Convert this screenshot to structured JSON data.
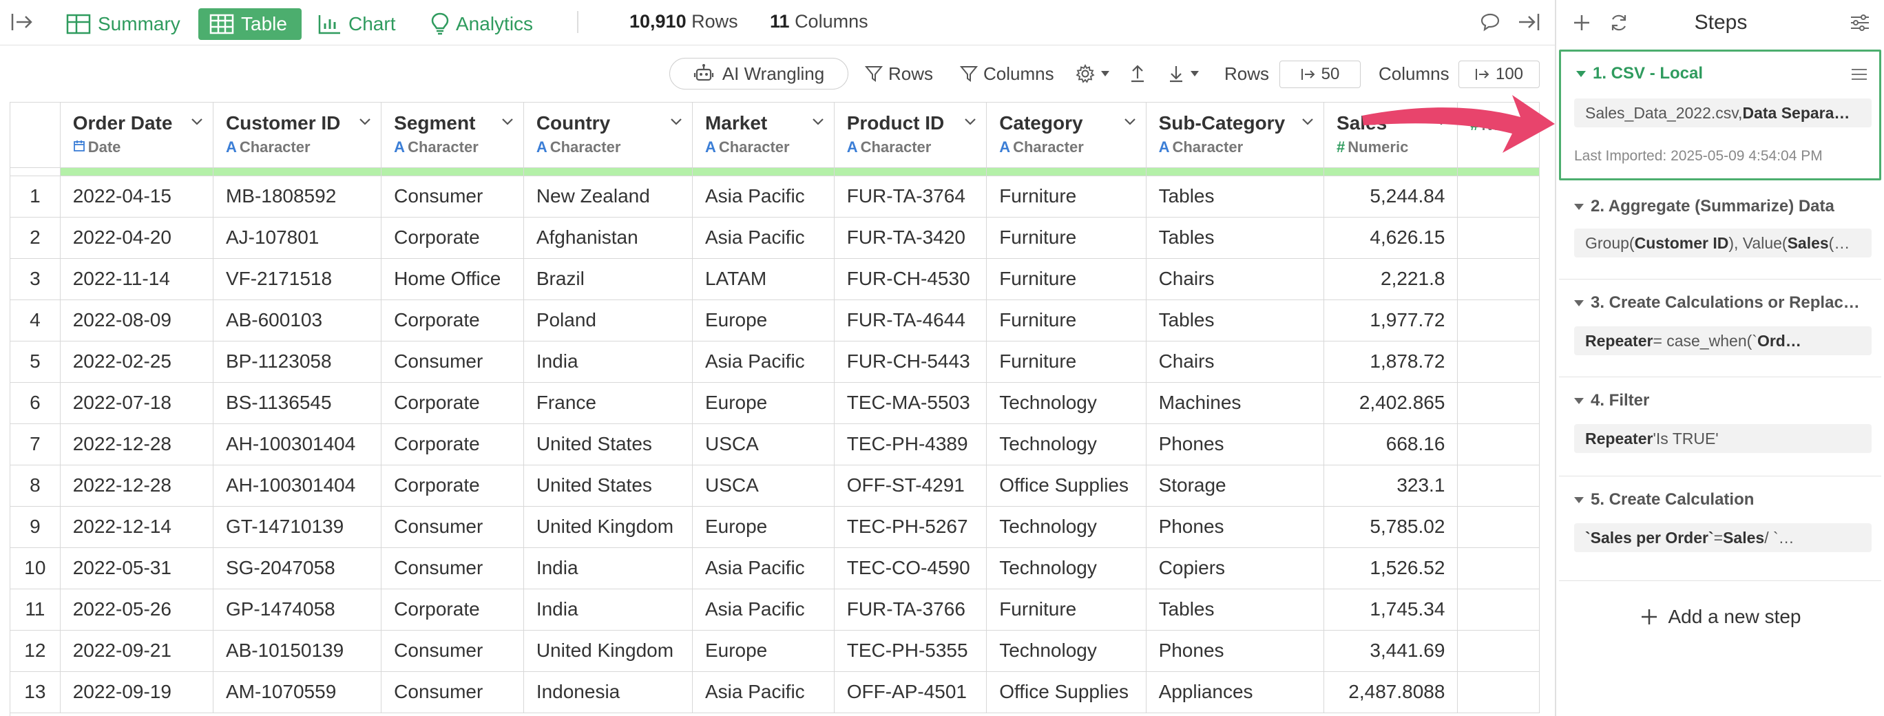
{
  "topbar": {
    "tabs": [
      {
        "label": "Summary",
        "icon": "summary-icon",
        "active": false
      },
      {
        "label": "Table",
        "icon": "table-icon",
        "active": true
      },
      {
        "label": "Chart",
        "icon": "chart-icon",
        "active": false
      },
      {
        "label": "Analytics",
        "icon": "lightbulb-icon",
        "active": false
      }
    ],
    "rows_count": "10,910",
    "rows_label": "Rows",
    "columns_count": "11",
    "columns_label": "Columns"
  },
  "toolbar": {
    "ai_wrangling": "AI Wrangling",
    "rows_filter": "Rows",
    "columns_filter": "Columns",
    "rows_label": "Rows",
    "rows_value": "50",
    "columns_label": "Columns",
    "columns_value": "100"
  },
  "table": {
    "columns": [
      {
        "name": "Order Date",
        "type": "Date"
      },
      {
        "name": "Customer ID",
        "type": "Character"
      },
      {
        "name": "Segment",
        "type": "Character"
      },
      {
        "name": "Country",
        "type": "Character"
      },
      {
        "name": "Market",
        "type": "Character"
      },
      {
        "name": "Product ID",
        "type": "Character"
      },
      {
        "name": "Category",
        "type": "Character"
      },
      {
        "name": "Sub-Category",
        "type": "Character"
      },
      {
        "name": "Sales",
        "type": "Numeric"
      },
      {
        "name": "",
        "type": "Num"
      }
    ],
    "rows": [
      [
        "1",
        "2022-04-15",
        "MB-1808592",
        "Consumer",
        "New Zealand",
        "Asia Pacific",
        "FUR-TA-3764",
        "Furniture",
        "Tables",
        "5,244.84"
      ],
      [
        "2",
        "2022-04-20",
        "AJ-107801",
        "Corporate",
        "Afghanistan",
        "Asia Pacific",
        "FUR-TA-3420",
        "Furniture",
        "Tables",
        "4,626.15"
      ],
      [
        "3",
        "2022-11-14",
        "VF-2171518",
        "Home Office",
        "Brazil",
        "LATAM",
        "FUR-CH-4530",
        "Furniture",
        "Chairs",
        "2,221.8"
      ],
      [
        "4",
        "2022-08-09",
        "AB-600103",
        "Corporate",
        "Poland",
        "Europe",
        "FUR-TA-4644",
        "Furniture",
        "Tables",
        "1,977.72"
      ],
      [
        "5",
        "2022-02-25",
        "BP-1123058",
        "Consumer",
        "India",
        "Asia Pacific",
        "FUR-CH-5443",
        "Furniture",
        "Chairs",
        "1,878.72"
      ],
      [
        "6",
        "2022-07-18",
        "BS-1136545",
        "Corporate",
        "France",
        "Europe",
        "TEC-MA-5503",
        "Technology",
        "Machines",
        "2,402.865"
      ],
      [
        "7",
        "2022-12-28",
        "AH-100301404",
        "Corporate",
        "United States",
        "USCA",
        "TEC-PH-4389",
        "Technology",
        "Phones",
        "668.16"
      ],
      [
        "8",
        "2022-12-28",
        "AH-100301404",
        "Corporate",
        "United States",
        "USCA",
        "OFF-ST-4291",
        "Office Supplies",
        "Storage",
        "323.1"
      ],
      [
        "9",
        "2022-12-14",
        "GT-14710139",
        "Consumer",
        "United Kingdom",
        "Europe",
        "TEC-PH-5267",
        "Technology",
        "Phones",
        "5,785.02"
      ],
      [
        "10",
        "2022-05-31",
        "SG-2047058",
        "Consumer",
        "India",
        "Asia Pacific",
        "TEC-CO-4590",
        "Technology",
        "Copiers",
        "1,526.52"
      ],
      [
        "11",
        "2022-05-26",
        "GP-1474058",
        "Corporate",
        "India",
        "Asia Pacific",
        "FUR-TA-3766",
        "Furniture",
        "Tables",
        "1,745.34"
      ],
      [
        "12",
        "2022-09-21",
        "AB-10150139",
        "Consumer",
        "United Kingdom",
        "Europe",
        "TEC-PH-5355",
        "Technology",
        "Phones",
        "3,441.69"
      ],
      [
        "13",
        "2022-09-19",
        "AM-1070559",
        "Consumer",
        "Indonesia",
        "Asia Pacific",
        "OFF-AP-4501",
        "Office Supplies",
        "Appliances",
        "2,487.8088"
      ]
    ]
  },
  "steps_panel": {
    "title": "Steps",
    "add_step": "Add a new step",
    "steps": [
      {
        "title": "1. CSV - Local",
        "detail_plain": "Sales_Data_2022.csv, ",
        "detail_bold": "Data Separa…",
        "meta": "Last Imported: 2025-05-09 4:54:04 PM"
      },
      {
        "title": "2. Aggregate (Summarize) Data",
        "detail_a": "Group(",
        "detail_b": "Customer ID",
        "detail_c": "), Value(",
        "detail_d": "Sales",
        "detail_e": " (…"
      },
      {
        "title": "3. Create Calculations or Replac…",
        "detail_bold": "Repeater",
        "detail_plain": " = case_when(`",
        "detail_bold2": "Ord…"
      },
      {
        "title": "4. Filter",
        "detail_bold": "Repeater",
        "detail_plain": " 'Is TRUE'"
      },
      {
        "title": "5. Create Calculation",
        "detail_bold": "`Sales per Order`",
        "detail_plain": " = ",
        "detail_bold2": "Sales",
        "detail_plain2": " / `…"
      }
    ]
  },
  "colors": {
    "accent_green": "#4cae6e",
    "text_green": "#2f9b5e",
    "character_blue": "#3b7ed6",
    "quality_bar": "#b4f0a8",
    "arrow_pink": "#e8446c"
  }
}
